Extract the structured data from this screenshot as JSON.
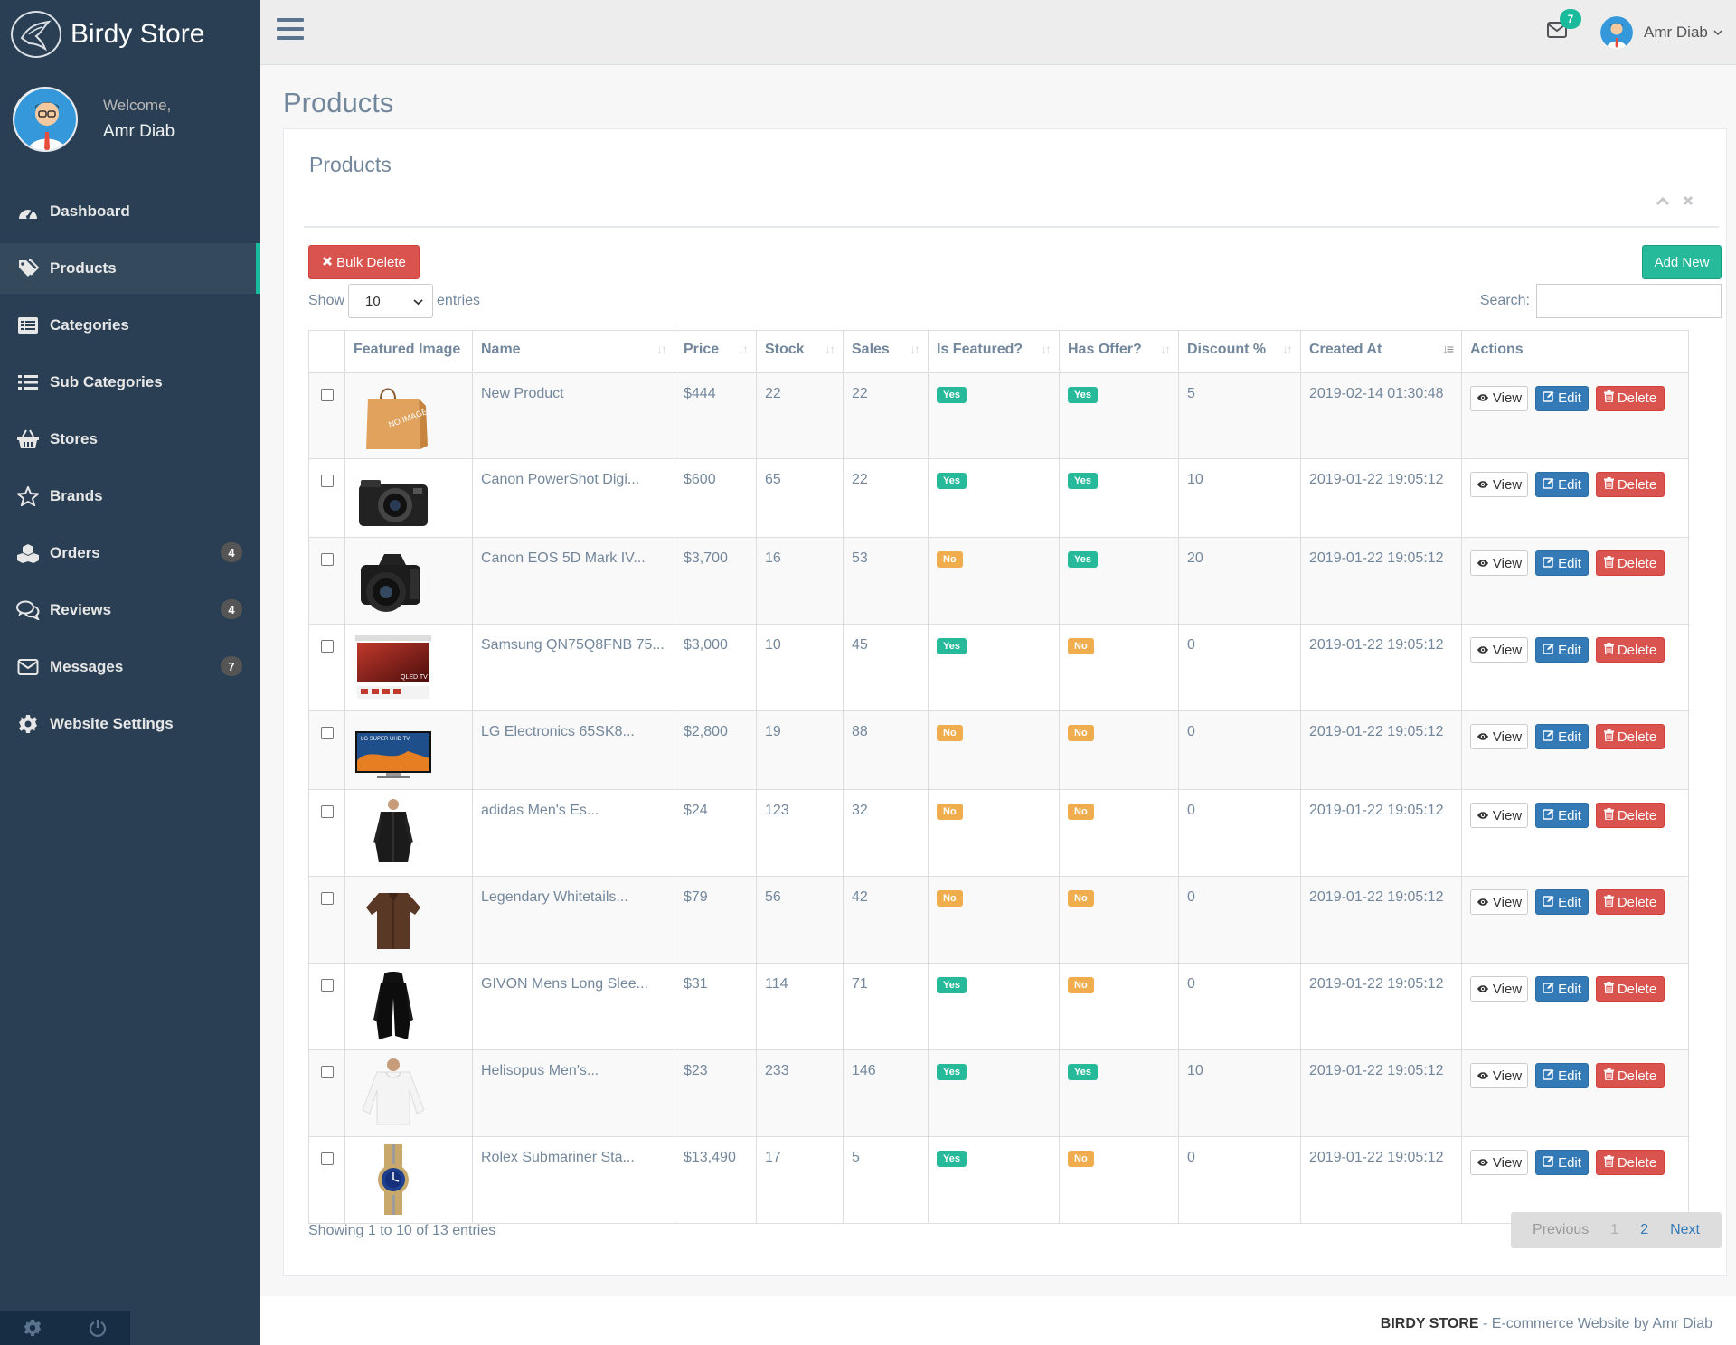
{
  "brand": {
    "title": "Birdy Store"
  },
  "profile": {
    "welcome": "Welcome,",
    "name": "Amr Diab"
  },
  "sidebar": {
    "items": [
      {
        "label": "Dashboard",
        "icon": "dashboard-icon",
        "badge": ""
      },
      {
        "label": "Products",
        "icon": "tags-icon",
        "badge": "",
        "active": true
      },
      {
        "label": "Categories",
        "icon": "list-alt-icon",
        "badge": ""
      },
      {
        "label": "Sub Categories",
        "icon": "list-icon",
        "badge": ""
      },
      {
        "label": "Stores",
        "icon": "shopping-basket-icon",
        "badge": ""
      },
      {
        "label": "Brands",
        "icon": "star-icon",
        "badge": ""
      },
      {
        "label": "Orders",
        "icon": "cubes-icon",
        "badge": "4"
      },
      {
        "label": "Reviews",
        "icon": "comments-icon",
        "badge": "4"
      },
      {
        "label": "Messages",
        "icon": "envelope-icon",
        "badge": "7"
      },
      {
        "label": "Website Settings",
        "icon": "cog-icon",
        "badge": ""
      }
    ]
  },
  "topnav": {
    "mail_count": "7",
    "user_name": "Amr Diab"
  },
  "page": {
    "title": "Products"
  },
  "panel": {
    "title": "Products"
  },
  "toolbar": {
    "bulk_delete": "Bulk Delete",
    "add_new": "Add New"
  },
  "length": {
    "show": "Show",
    "value": "10",
    "entries": "entries"
  },
  "search": {
    "label": "Search:",
    "value": ""
  },
  "table": {
    "columns": [
      "",
      "Featured Image",
      "Name",
      "Price",
      "Stock",
      "Sales",
      "Is Featured?",
      "Has Offer?",
      "Discount %",
      "Created At",
      "Actions"
    ],
    "actions": {
      "view": "View",
      "edit": "Edit",
      "delete": "Delete"
    },
    "rows": [
      {
        "image": "paper-bag-no-image",
        "name": "New Product",
        "price": "$444",
        "stock": "22",
        "sales": "22",
        "featured": "Yes",
        "offer": "Yes",
        "discount": "5",
        "created": "2019-02-14 01:30:48"
      },
      {
        "image": "compact-camera",
        "name": "Canon PowerShot Digi...",
        "price": "$600",
        "stock": "65",
        "sales": "22",
        "featured": "Yes",
        "offer": "Yes",
        "discount": "10",
        "created": "2019-01-22 19:05:12"
      },
      {
        "image": "dslr-camera",
        "name": "Canon EOS 5D Mark IV...",
        "price": "$3,700",
        "stock": "16",
        "sales": "53",
        "featured": "No",
        "offer": "Yes",
        "discount": "20",
        "created": "2019-01-22 19:05:12"
      },
      {
        "image": "qled-tv",
        "name": "Samsung QN75Q8FNB 75...",
        "price": "$3,000",
        "stock": "10",
        "sales": "45",
        "featured": "Yes",
        "offer": "No",
        "discount": "0",
        "created": "2019-01-22 19:05:12"
      },
      {
        "image": "lg-tv",
        "name": "LG Electronics 65SK8...",
        "price": "$2,800",
        "stock": "19",
        "sales": "88",
        "featured": "No",
        "offer": "No",
        "discount": "0",
        "created": "2019-01-22 19:05:12"
      },
      {
        "image": "black-jacket",
        "name": "adidas Men's Es...",
        "price": "$24",
        "stock": "123",
        "sales": "32",
        "featured": "No",
        "offer": "No",
        "discount": "0",
        "created": "2019-01-22 19:05:12"
      },
      {
        "image": "brown-shirt",
        "name": "Legendary Whitetails...",
        "price": "$79",
        "stock": "56",
        "sales": "42",
        "featured": "No",
        "offer": "No",
        "discount": "0",
        "created": "2019-01-22 19:05:12"
      },
      {
        "image": "black-cardigan",
        "name": "GIVON Mens Long Slee...",
        "price": "$31",
        "stock": "114",
        "sales": "71",
        "featured": "Yes",
        "offer": "No",
        "discount": "0",
        "created": "2019-01-22 19:05:12"
      },
      {
        "image": "white-sweater",
        "name": "Helisopus Men's...",
        "price": "$23",
        "stock": "233",
        "sales": "146",
        "featured": "Yes",
        "offer": "Yes",
        "discount": "10",
        "created": "2019-01-22 19:05:12"
      },
      {
        "image": "rolex-watch",
        "name": "Rolex Submariner Sta...",
        "price": "$13,490",
        "stock": "17",
        "sales": "5",
        "featured": "Yes",
        "offer": "No",
        "discount": "0",
        "created": "2019-01-22 19:05:12"
      }
    ]
  },
  "info": "Showing 1 to 10 of 13 entries",
  "pager": {
    "previous": "Previous",
    "pages": [
      "1",
      "2"
    ],
    "next": "Next"
  },
  "footer": {
    "brand": "BIRDY STORE",
    "text": " - E-commerce Website by Amr Diab"
  },
  "colors": {
    "sidebar": "#2a3f54",
    "accent": "#1abb9c",
    "danger": "#d9534f",
    "primary": "#337ab7",
    "warning": "#f0ad4e"
  }
}
